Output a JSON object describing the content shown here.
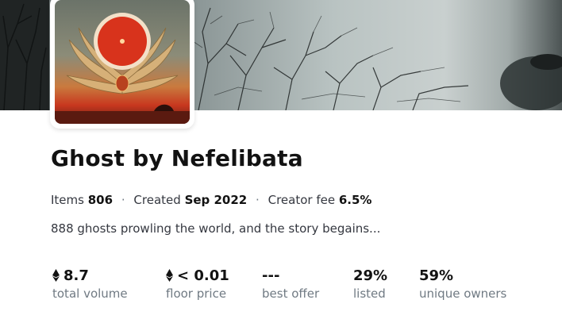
{
  "collection": {
    "name": "Ghost by Nefelibata",
    "items_label": "Items",
    "items_value": "806",
    "separator": "·",
    "created_label": "Created",
    "created_value": "Sep 2022",
    "fee_label": "Creator fee",
    "fee_value": "6.5%",
    "description": "888 ghosts prowling the world, and the story begains..."
  },
  "stats": [
    {
      "value": "8.7",
      "label": "total volume",
      "icon": "ethereum-icon"
    },
    {
      "value": "< 0.01",
      "label": "floor price",
      "icon": "ethereum-icon"
    },
    {
      "value": "---",
      "label": "best offer"
    },
    {
      "value": "29%",
      "label": "listed"
    },
    {
      "value": "59%",
      "label": "unique owners"
    }
  ],
  "colors": {
    "text_primary": "#121212",
    "text_secondary": "#707a83",
    "sun_red": "#d8331c"
  }
}
